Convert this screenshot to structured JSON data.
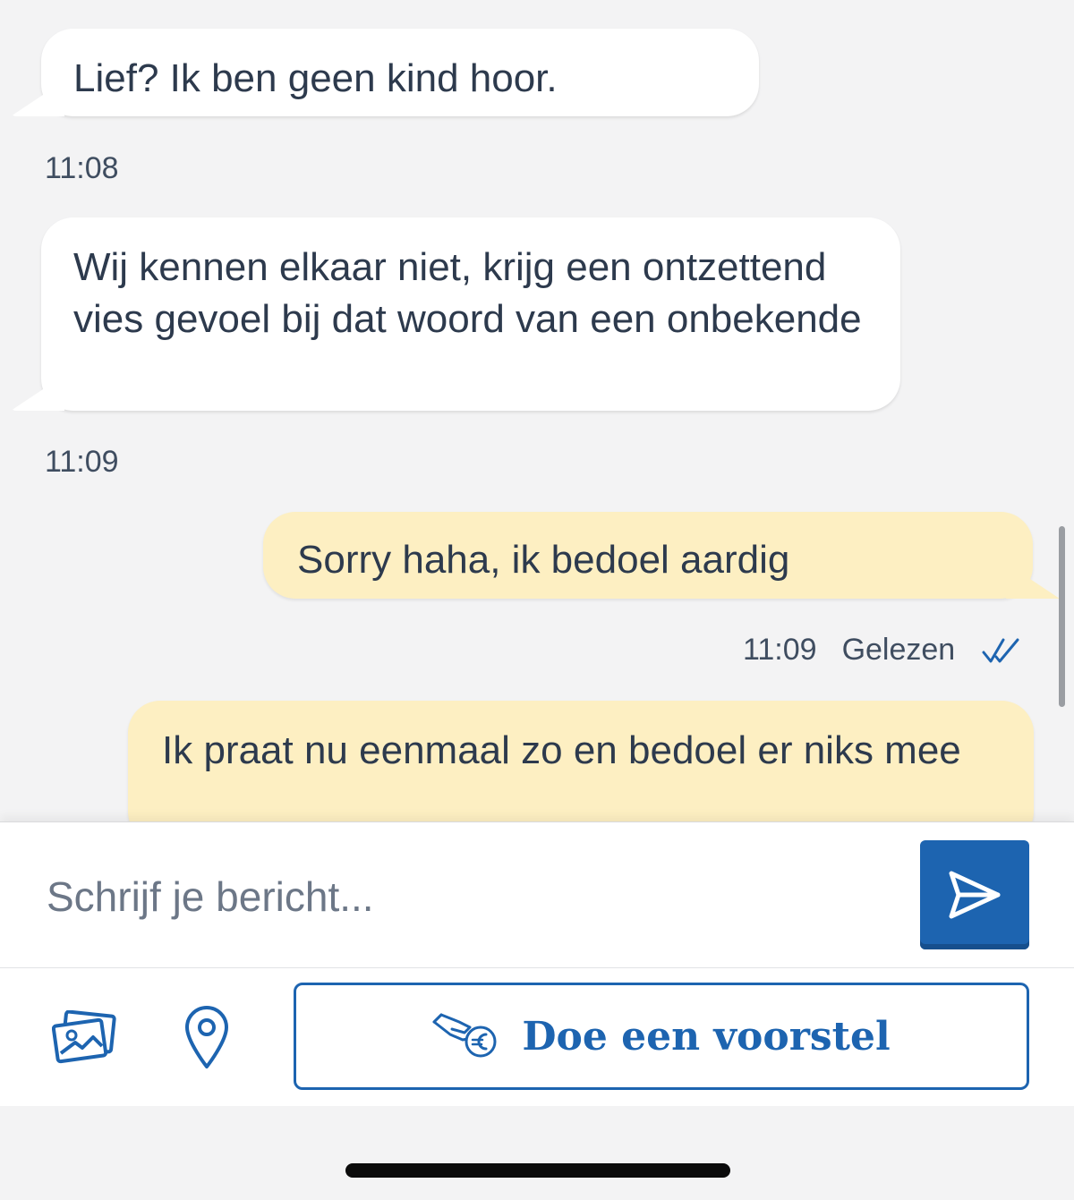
{
  "messages": [
    {
      "direction": "incoming",
      "text": "Lief? Ik ben geen kind hoor.",
      "time": "11:08"
    },
    {
      "direction": "incoming",
      "text": "Wij kennen elkaar niet, krijg een ontzettend vies gevoel bij dat woord van een onbekende",
      "time": "11:09"
    },
    {
      "direction": "outgoing",
      "text": "Sorry haha, ik bedoel aardig",
      "time": "11:09",
      "status": "Gelezen"
    },
    {
      "direction": "outgoing",
      "text": "Ik praat nu eenmaal zo en bedoel er niks mee"
    }
  ],
  "composer": {
    "placeholder": "Schrijf je bericht...",
    "send_icon": "send-icon"
  },
  "actions": {
    "photo_icon": "photo-gallery-icon",
    "location_icon": "location-pin-icon",
    "offer_icon": "hand-euro-icon",
    "offer_label": "Doe een voorstel"
  },
  "colors": {
    "incoming_bubble": "#ffffff",
    "outgoing_bubble": "#fdefc2",
    "accent": "#1d64b0",
    "background": "#f3f3f4"
  }
}
